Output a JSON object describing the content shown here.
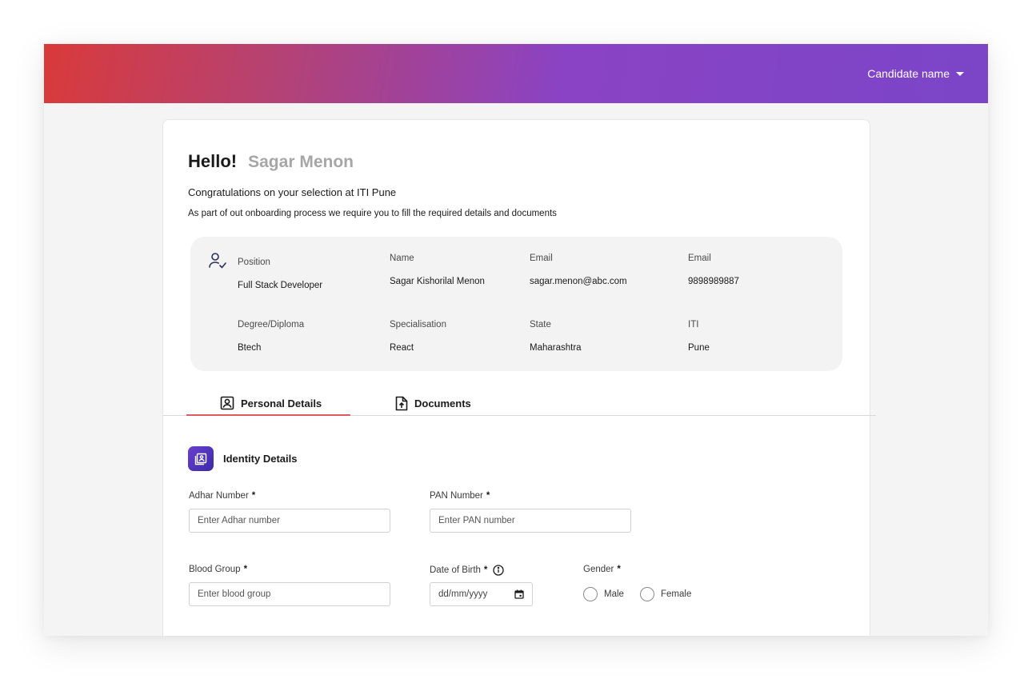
{
  "header": {
    "user_menu_label": "Candidate name",
    "gradient": [
      "#d93a3a",
      "#8a43c4",
      "#7b45c8"
    ]
  },
  "greeting": {
    "hello": "Hello!",
    "candidate_name": "Sagar Menon",
    "congrats": "Congratulations on your selection at ITI Pune",
    "instruction": "As part of out onboarding process we require you to fill the required details and documents"
  },
  "info": {
    "position": {
      "label": "Position",
      "value": "Full Stack Developer"
    },
    "name": {
      "label": "Name",
      "value": "Sagar Kishorilal Menon"
    },
    "email": {
      "label": "Email",
      "value": "sagar.menon@abc.com"
    },
    "phone": {
      "label": "Email",
      "value": "9898989887"
    },
    "degree": {
      "label": "Degree/Diploma",
      "value": "Btech"
    },
    "specialisation": {
      "label": "Specialisation",
      "value": "React"
    },
    "state": {
      "label": "State",
      "value": "Maharashtra"
    },
    "iti": {
      "label": "ITI",
      "value": "Pune"
    }
  },
  "tabs": [
    {
      "label": "Personal Details",
      "icon": "person-badge-icon",
      "active": true
    },
    {
      "label": "Documents",
      "icon": "file-upload-icon",
      "active": false
    }
  ],
  "section": {
    "title": "Identity Details",
    "icon": "identity-card-icon"
  },
  "form": {
    "adhar": {
      "label": "Adhar Number",
      "required": "*",
      "placeholder": "Enter Adhar number"
    },
    "pan": {
      "label": "PAN Number",
      "required": "*",
      "placeholder": "Enter PAN number"
    },
    "blood": {
      "label": "Blood Group",
      "required": "*",
      "placeholder": "Enter blood group"
    },
    "dob": {
      "label": "Date of Birth",
      "required": "*",
      "placeholder": "dd/mm/yyyy"
    },
    "gender": {
      "label": "Gender",
      "required": "*",
      "options": [
        "Male",
        "Female"
      ]
    }
  },
  "colors": {
    "accent": "#e05a5a",
    "brand": "#7b45c8"
  }
}
